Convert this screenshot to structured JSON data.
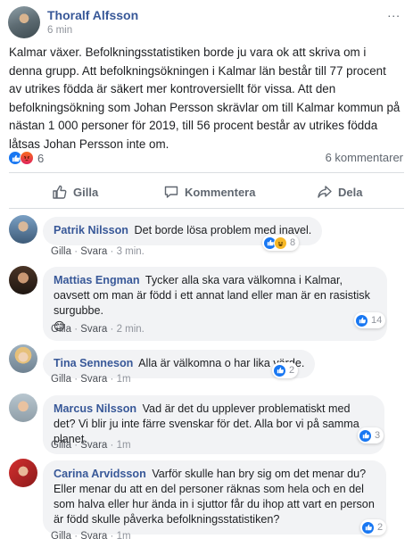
{
  "post": {
    "author": "Thoralf Alfsson",
    "time": "6 min",
    "text": "Kalmar växer. Befolkningsstatistiken borde ju vara ok att skriva om i denna grupp. Att befolkningsökningen i Kalmar län består till 77 procent av utrikes födda är säkert mer kontroversiellt för vissa. Att den befolkningsökning som Johan Persson skrävlar om till Kalmar kommun på nästan 1 000 personer för 2019, till 56 procent består av utrikes födda låtsas Johan Persson inte om.",
    "reaction_count": "6",
    "comment_count": "6 kommentarer",
    "more_icon": "..."
  },
  "actions": {
    "like": "Gilla",
    "comment": "Kommentera",
    "share": "Dela"
  },
  "comment_meta": {
    "like": "Gilla",
    "reply": "Svara",
    "sep": "·"
  },
  "comments": [
    {
      "name": "Patrik Nilsson",
      "text": "Det borde lösa problem med inavel.",
      "time": "3 min.",
      "reactions": "8",
      "reaction_icons": [
        "like-icon",
        "haha-icon"
      ]
    },
    {
      "name": "Mattias Engman",
      "text": "Tycker alla ska vara välkomna i Kalmar, oavsett om man är född i ett annat land eller man är en rasistisk surgubbe.",
      "emoji": "😊",
      "time": "2 min.",
      "reactions": "14",
      "reaction_icons": [
        "like-icon"
      ]
    },
    {
      "name": "Tina Senneson",
      "text": "Alla är välkomna o har lika värde.",
      "time": "1m",
      "reactions": "2",
      "reaction_icons": [
        "like-icon"
      ]
    },
    {
      "name": "Marcus Nilsson",
      "text": "Vad är det du upplever problematiskt med det? Vi blir ju inte färre svenskar för det. Alla bor vi på samma planet.",
      "time": "1m",
      "reactions": "3",
      "reaction_icons": [
        "like-icon"
      ]
    },
    {
      "name": "Carina Arvidsson",
      "text": "Varför skulle han bry sig om det menar du? Eller menar du att en del personer räknas som hela och en del som halva eller hur ända in i sjuttor får du ihop att vart en person är född skulle påverka befolkningsstatistiken?",
      "time": "1m",
      "reactions": "2",
      "reaction_icons": [
        "like-icon"
      ]
    }
  ],
  "colors": {
    "name_link": "#385898",
    "like_blue": "#1877f2",
    "bubble_bg": "#f2f3f5",
    "meta_grey": "#90949c"
  }
}
